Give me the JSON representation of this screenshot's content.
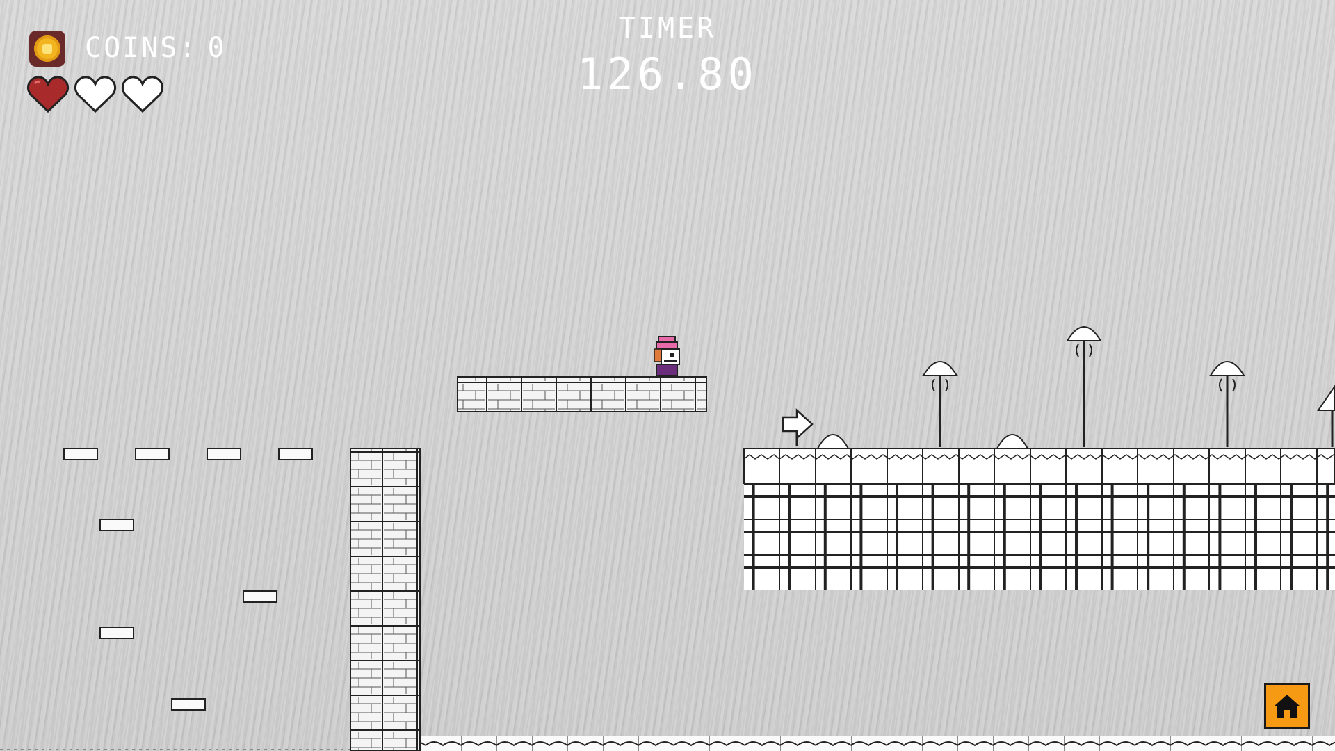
{
  "hud": {
    "coins_label": "COINS:",
    "coins_value": "0",
    "timer_label": "TIMER",
    "timer_value": "126.80",
    "hearts": {
      "total": 3,
      "filled": 1
    }
  },
  "colors": {
    "heart_filled": "#a82a2a",
    "heart_empty": "#ffffff",
    "home_button": "#f59a12",
    "coin": "#f3b51f",
    "coin_border": "#6b2a2a",
    "player_hat": "#e86aa8",
    "player_body": "#6b2e7a"
  },
  "icons": {
    "coin": "coin-icon",
    "heart": "heart-icon",
    "home": "home-icon",
    "sign": "arrow-right-sign",
    "lamp": "mushroom-lamp"
  }
}
